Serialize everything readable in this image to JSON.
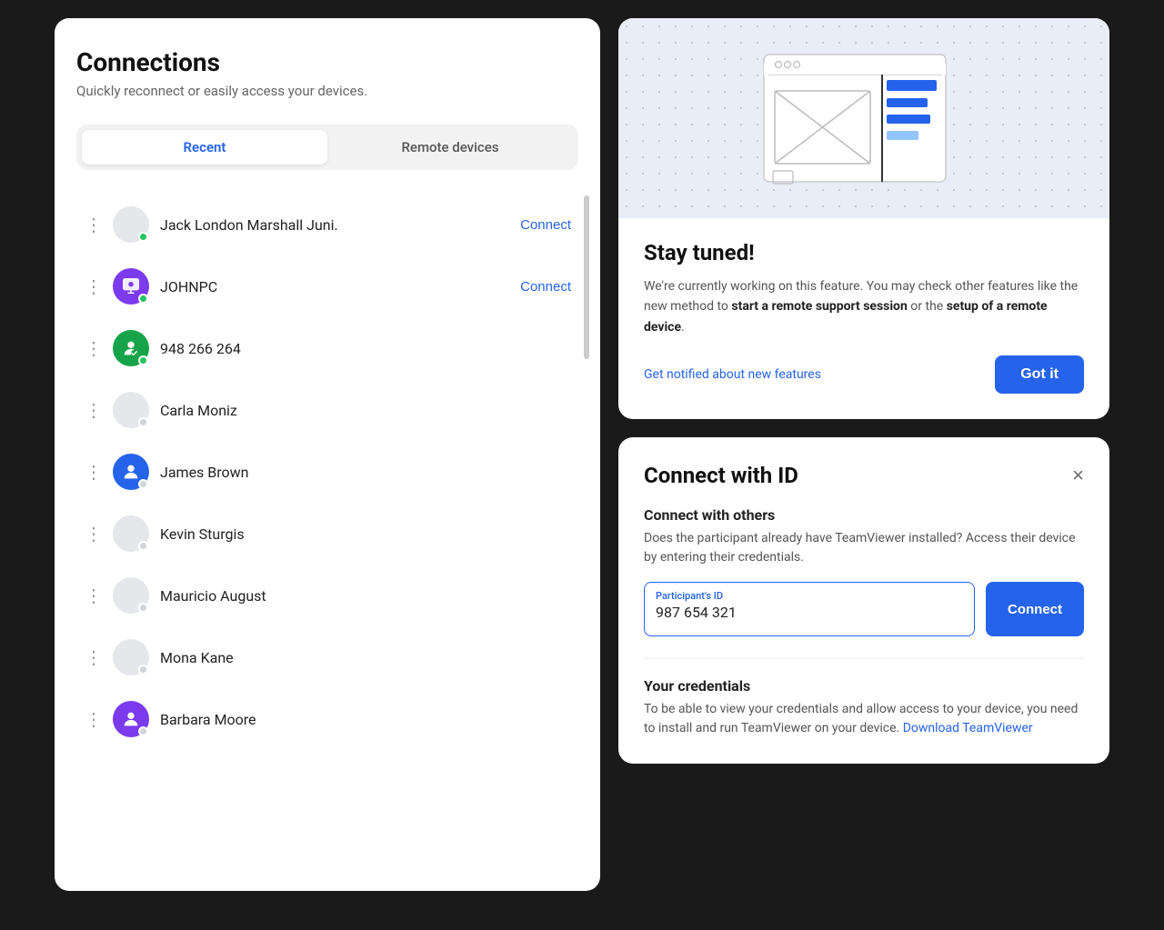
{
  "left": {
    "title": "Connections",
    "subtitle": "Quickly reconnect or easily access your devices.",
    "tabs": [
      {
        "label": "Recent",
        "active": true
      },
      {
        "label": "Remote devices",
        "active": false
      }
    ],
    "connections": [
      {
        "name": "Jack London Marshall Juni.",
        "status": "online",
        "hasAvatar": false,
        "avatarColor": "",
        "avatarType": "dot",
        "showConnect": true
      },
      {
        "name": "JOHNPC",
        "status": "online",
        "hasAvatar": true,
        "avatarColor": "bg-purple",
        "avatarType": "monitor",
        "showConnect": true
      },
      {
        "name": "948 266 264",
        "status": "online",
        "hasAvatar": true,
        "avatarColor": "bg-green",
        "avatarType": "person",
        "showConnect": false
      },
      {
        "name": "Carla Moniz",
        "status": "offline",
        "hasAvatar": false,
        "avatarColor": "",
        "avatarType": "none",
        "showConnect": false
      },
      {
        "name": "James Brown",
        "status": "offline",
        "hasAvatar": true,
        "avatarColor": "bg-blue",
        "avatarType": "person",
        "showConnect": false
      },
      {
        "name": "Kevin Sturgis",
        "status": "offline",
        "hasAvatar": false,
        "avatarColor": "",
        "avatarType": "none",
        "showConnect": false
      },
      {
        "name": "Mauricio August",
        "status": "offline",
        "hasAvatar": false,
        "avatarColor": "",
        "avatarType": "none",
        "showConnect": false
      },
      {
        "name": "Mona Kane",
        "status": "offline",
        "hasAvatar": false,
        "avatarColor": "",
        "avatarType": "none",
        "showConnect": false
      },
      {
        "name": "Barbara Moore",
        "status": "offline",
        "hasAvatar": true,
        "avatarColor": "bg-violet",
        "avatarType": "person",
        "showConnect": false
      }
    ],
    "connect_label": "Connect"
  },
  "right": {
    "stay_tuned": {
      "title": "Stay tuned!",
      "description_part1": "We're currently working on this feature. You may check other features like the new method to ",
      "description_bold1": "start a remote support session",
      "description_part2": " or the ",
      "description_bold2": "setup of a remote device",
      "description_part3": ".",
      "notify_link": "Get notified about new features",
      "got_it_label": "Got it"
    },
    "connect_id": {
      "title": "Connect with ID",
      "close_label": "×",
      "section_title": "Connect with others",
      "section_desc": "Does the participant already have TeamViewer installed? Access their device by entering their credentials.",
      "input_label": "Participant's ID",
      "input_value": "987 654 321",
      "connect_btn_label": "Connect",
      "credentials_title": "Your credentials",
      "credentials_desc": "To be able to view your credentials and allow access to your device, you need to install and run TeamViewer on your device. ",
      "download_link": "Download TeamViewer"
    }
  }
}
